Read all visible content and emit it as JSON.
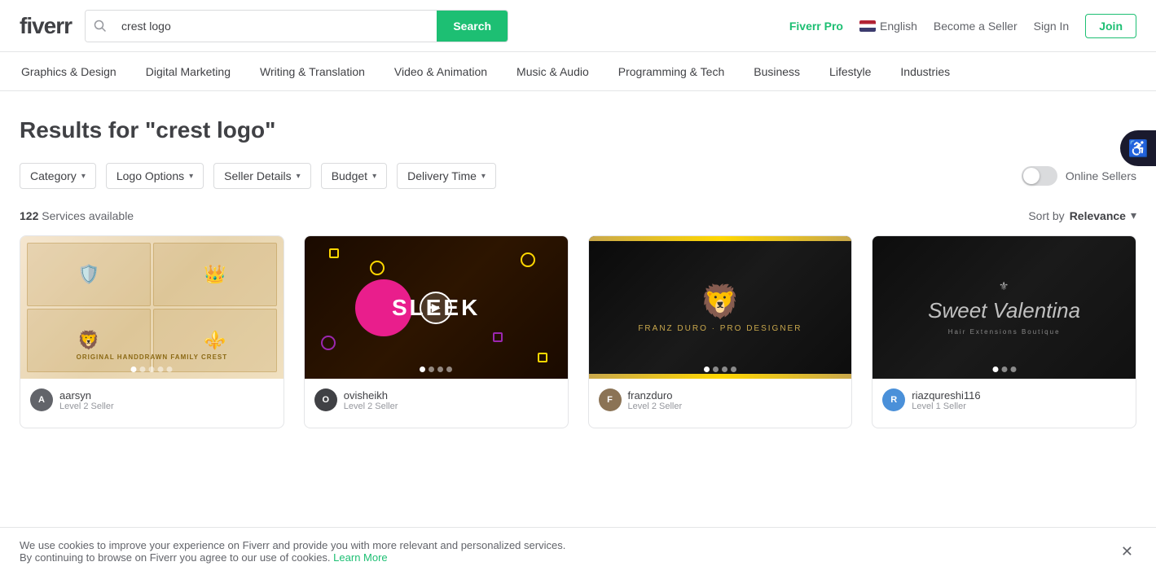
{
  "header": {
    "logo": "fiverr",
    "search_placeholder": "crest logo",
    "search_value": "crest logo",
    "search_button": "Search",
    "fiverr_pro": "Fiverr Pro",
    "language": "English",
    "become_seller": "Become a Seller",
    "sign_in": "Sign In",
    "join": "Join"
  },
  "nav": {
    "items": [
      {
        "label": "Graphics & Design"
      },
      {
        "label": "Digital Marketing"
      },
      {
        "label": "Writing & Translation"
      },
      {
        "label": "Video & Animation"
      },
      {
        "label": "Music & Audio"
      },
      {
        "label": "Programming & Tech"
      },
      {
        "label": "Business"
      },
      {
        "label": "Lifestyle"
      },
      {
        "label": "Industries"
      }
    ]
  },
  "results": {
    "title": "Results for \"crest logo\"",
    "count": "122",
    "count_label": "Services available",
    "sort_label": "Sort by",
    "sort_value": "Relevance"
  },
  "filters": [
    {
      "label": "Category"
    },
    {
      "label": "Logo Options"
    },
    {
      "label": "Seller Details"
    },
    {
      "label": "Budget"
    },
    {
      "label": "Delivery Time"
    }
  ],
  "online_sellers_label": "Online Sellers",
  "cards": [
    {
      "seller": "aarsyn",
      "level": "Level 2 Seller",
      "dots": 5,
      "active_dot": 0,
      "avatar_letter": "A",
      "avatar_class": "avatar-1"
    },
    {
      "seller": "ovisheikh",
      "level": "Level 2 Seller",
      "dots": 4,
      "active_dot": 0,
      "has_play": true,
      "avatar_letter": "O",
      "avatar_class": "avatar-2"
    },
    {
      "seller": "franzduro",
      "level": "Level 2 Seller",
      "dots": 4,
      "active_dot": 0,
      "avatar_letter": "F",
      "avatar_class": "avatar-3"
    },
    {
      "seller": "riazqureshi116",
      "level": "Level 1 Seller",
      "dots": 3,
      "active_dot": 0,
      "avatar_letter": "R",
      "avatar_class": "avatar-4"
    }
  ],
  "cookie": {
    "text1": "We use cookies to improve your experience on Fiverr and provide you with more relevant and personalized services.",
    "text2": "By continuing to browse on Fiverr you agree to our use of cookies.",
    "link_text": "Learn More"
  }
}
